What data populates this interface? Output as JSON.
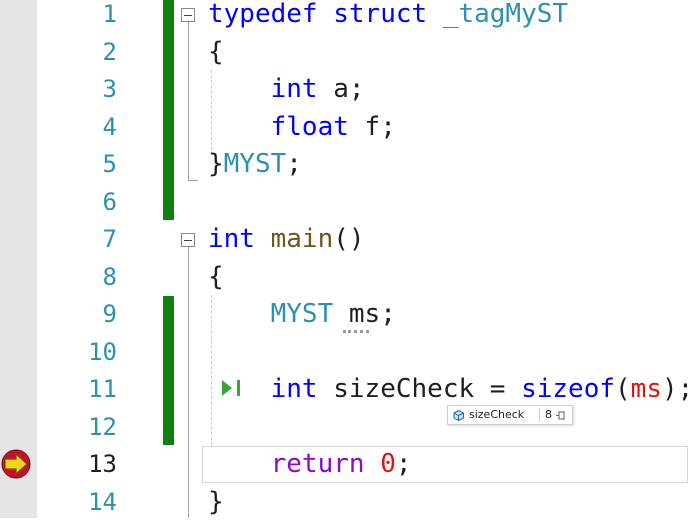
{
  "editor": {
    "line_numbers": [
      "1",
      "2",
      "3",
      "4",
      "5",
      "6",
      "7",
      "8",
      "9",
      "10",
      "11",
      "12",
      "13",
      "14"
    ],
    "current_line": "13",
    "lines": [
      [
        {
          "t": "typedef",
          "c": "kw"
        },
        {
          "t": " "
        },
        {
          "t": "struct",
          "c": "kw"
        },
        {
          "t": " "
        },
        {
          "t": "_tagMyST",
          "c": "ty"
        }
      ],
      [
        {
          "t": "{"
        }
      ],
      [
        {
          "t": "    "
        },
        {
          "t": "int",
          "c": "kw"
        },
        {
          "t": " a;"
        }
      ],
      [
        {
          "t": "    "
        },
        {
          "t": "float",
          "c": "kw"
        },
        {
          "t": " f;"
        }
      ],
      [
        {
          "t": "}"
        },
        {
          "t": "MYST",
          "c": "ty"
        },
        {
          "t": ";"
        }
      ],
      [],
      [
        {
          "t": "int",
          "c": "kw"
        },
        {
          "t": " "
        },
        {
          "t": "main",
          "c": "fn"
        },
        {
          "t": "()"
        }
      ],
      [
        {
          "t": "{"
        }
      ],
      [
        {
          "t": "    "
        },
        {
          "t": "MYST",
          "c": "ty"
        },
        {
          "t": " ms;"
        }
      ],
      [],
      [
        {
          "t": "    "
        },
        {
          "t": "int",
          "c": "kw"
        },
        {
          "t": " sizeCheck = "
        },
        {
          "t": "sizeof",
          "c": "kw"
        },
        {
          "t": "("
        },
        {
          "t": "ms",
          "c": "param"
        },
        {
          "t": ");"
        }
      ],
      [],
      [
        {
          "t": "    "
        },
        {
          "t": "return",
          "c": "pl"
        },
        {
          "t": " "
        },
        {
          "t": "0",
          "c": "num"
        },
        {
          "t": ";"
        }
      ],
      [
        {
          "t": "}"
        }
      ]
    ]
  },
  "datatip": {
    "variable": "sizeCheck",
    "value": "8",
    "icon": "variable-icon",
    "pin_icon": "pin-icon"
  },
  "glyphs": {
    "breakpoint_arrow": "current-statement-arrow-icon",
    "run_to_click": "run-to-click-icon"
  },
  "colors": {
    "keyword": "#0000ff",
    "type": "#2b91af",
    "change_bar": "#108010",
    "number": "#e11414"
  }
}
